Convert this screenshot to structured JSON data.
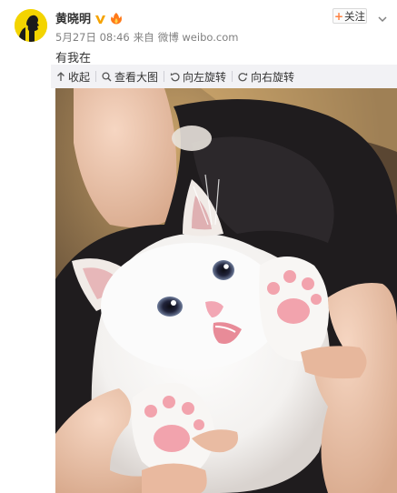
{
  "post": {
    "author": "黄晓明",
    "date": "5月27日 08:46",
    "source_prefix": "来自",
    "source": "微博 weibo.com",
    "text": "有我在",
    "follow_label": "关注"
  },
  "toolbar": {
    "collapse_label": "收起",
    "view_large_label": "查看大图",
    "rotate_left_label": "向左旋转",
    "rotate_right_label": "向右旋转"
  },
  "icons": {
    "verified": "yellow-v-icon",
    "badge": "fire-badge-icon",
    "follow_plus": "plus-icon",
    "more": "chevron-down-icon",
    "collapse": "arrow-up-icon",
    "view_large": "magnifier-icon",
    "rotate_left": "rotate-left-icon",
    "rotate_right": "rotate-right-icon"
  },
  "colors": {
    "accent_orange": "#ff8140",
    "toolbar_bg": "#f2f2f5",
    "avatar_bg": "#f3d400",
    "meta_text": "#808080"
  }
}
